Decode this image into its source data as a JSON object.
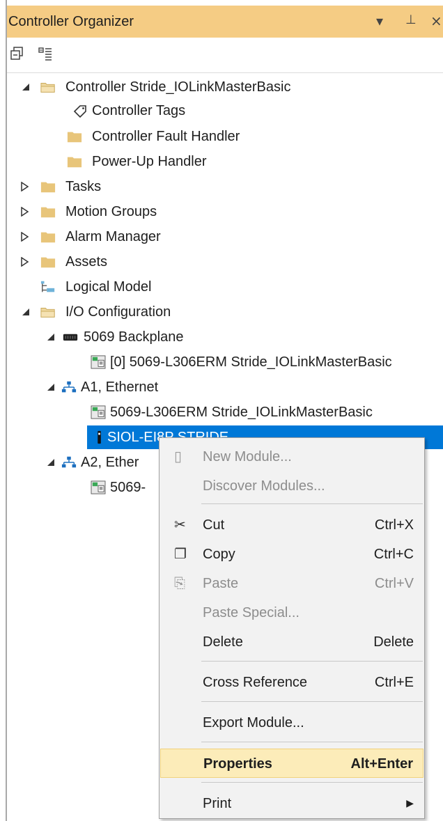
{
  "panel": {
    "title": "Controller Organizer",
    "dropdown_icon": "chevron-down-icon",
    "pin_icon": "pin-icon",
    "close_icon": "close-icon"
  },
  "toolbar": {
    "buttons": [
      "collapse-all-icon",
      "expand-all-icon"
    ]
  },
  "tree": {
    "controller": "Controller Stride_IOLinkMasterBasic",
    "controller_tags": "Controller Tags",
    "fault_handler": "Controller Fault Handler",
    "powerup_handler": "Power-Up Handler",
    "tasks": "Tasks",
    "motion_groups": "Motion Groups",
    "alarm_manager": "Alarm Manager",
    "assets": "Assets",
    "logical_model": "Logical Model",
    "io_config": "I/O Configuration",
    "backplane": "5069 Backplane",
    "backplane_module": "[0] 5069-L306ERM Stride_IOLinkMasterBasic",
    "a1_ethernet": "A1, Ethernet",
    "a1_module": "5069-L306ERM Stride_IOLinkMasterBasic",
    "a1_selected": "SIOL-EI8P STRIDE",
    "a2_ethernet": "A2, Ether",
    "a2_module": "5069-"
  },
  "context_menu": {
    "new_module": "New Module...",
    "discover_modules": "Discover Modules...",
    "cut": "Cut",
    "cut_key": "Ctrl+X",
    "copy": "Copy",
    "copy_key": "Ctrl+C",
    "paste": "Paste",
    "paste_key": "Ctrl+V",
    "paste_special": "Paste Special...",
    "delete": "Delete",
    "delete_key": "Delete",
    "cross_reference": "Cross Reference",
    "cross_reference_key": "Ctrl+E",
    "export_module": "Export Module...",
    "properties": "Properties",
    "properties_key": "Alt+Enter",
    "print": "Print"
  },
  "colors": {
    "title_bar": "#f5cc84",
    "selection": "#0078d7",
    "menu_highlight": "#fcecb9",
    "folder": "#e8c57a"
  }
}
